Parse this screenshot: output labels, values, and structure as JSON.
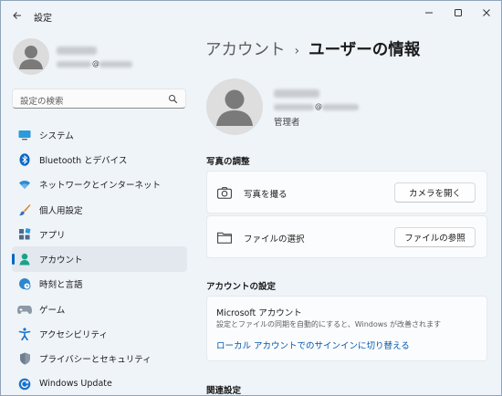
{
  "window": {
    "app_title": "設定",
    "controls": [
      "minimize-icon",
      "maximize-icon",
      "close-icon"
    ]
  },
  "profile": {
    "email_at": "@"
  },
  "search": {
    "placeholder": "設定の検索"
  },
  "nav": {
    "items": [
      {
        "label": "システム",
        "icon": "monitor-icon"
      },
      {
        "label": "Bluetooth とデバイス",
        "icon": "bluetooth-icon"
      },
      {
        "label": "ネットワークとインターネット",
        "icon": "wifi-icon"
      },
      {
        "label": "個人用設定",
        "icon": "paintbrush-icon"
      },
      {
        "label": "アプリ",
        "icon": "apps-icon"
      },
      {
        "label": "アカウント",
        "icon": "account-icon",
        "selected": true
      },
      {
        "label": "時刻と言語",
        "icon": "globe-clock-icon"
      },
      {
        "label": "ゲーム",
        "icon": "gamepad-icon"
      },
      {
        "label": "アクセシビリティ",
        "icon": "accessibility-icon"
      },
      {
        "label": "プライバシーとセキュリティ",
        "icon": "shield-icon"
      },
      {
        "label": "Windows Update",
        "icon": "update-icon"
      }
    ]
  },
  "breadcrumb": {
    "parent": "アカウント",
    "separator": "›",
    "current": "ユーザーの情報"
  },
  "user": {
    "email_at": "@",
    "role": "管理者"
  },
  "photo_section": {
    "title": "写真の調整",
    "rows": [
      {
        "label": "写真を撮る",
        "icon": "camera-icon",
        "button": "カメラを開く"
      },
      {
        "label": "ファイルの選択",
        "icon": "folder-icon",
        "button": "ファイルの参照"
      }
    ]
  },
  "account_section": {
    "title": "アカウントの設定",
    "card_title": "Microsoft アカウント",
    "description": "設定とファイルの同期を自動的にすると、Windows が改善されます",
    "link": "ローカル アカウントでのサインインに切り替える"
  },
  "related": {
    "title": "関連設定"
  },
  "colors": {
    "accent": "#0067c0",
    "link": "#0058b0",
    "window_bg": "#eff4f9",
    "card_bg": "#fbfcfd"
  }
}
